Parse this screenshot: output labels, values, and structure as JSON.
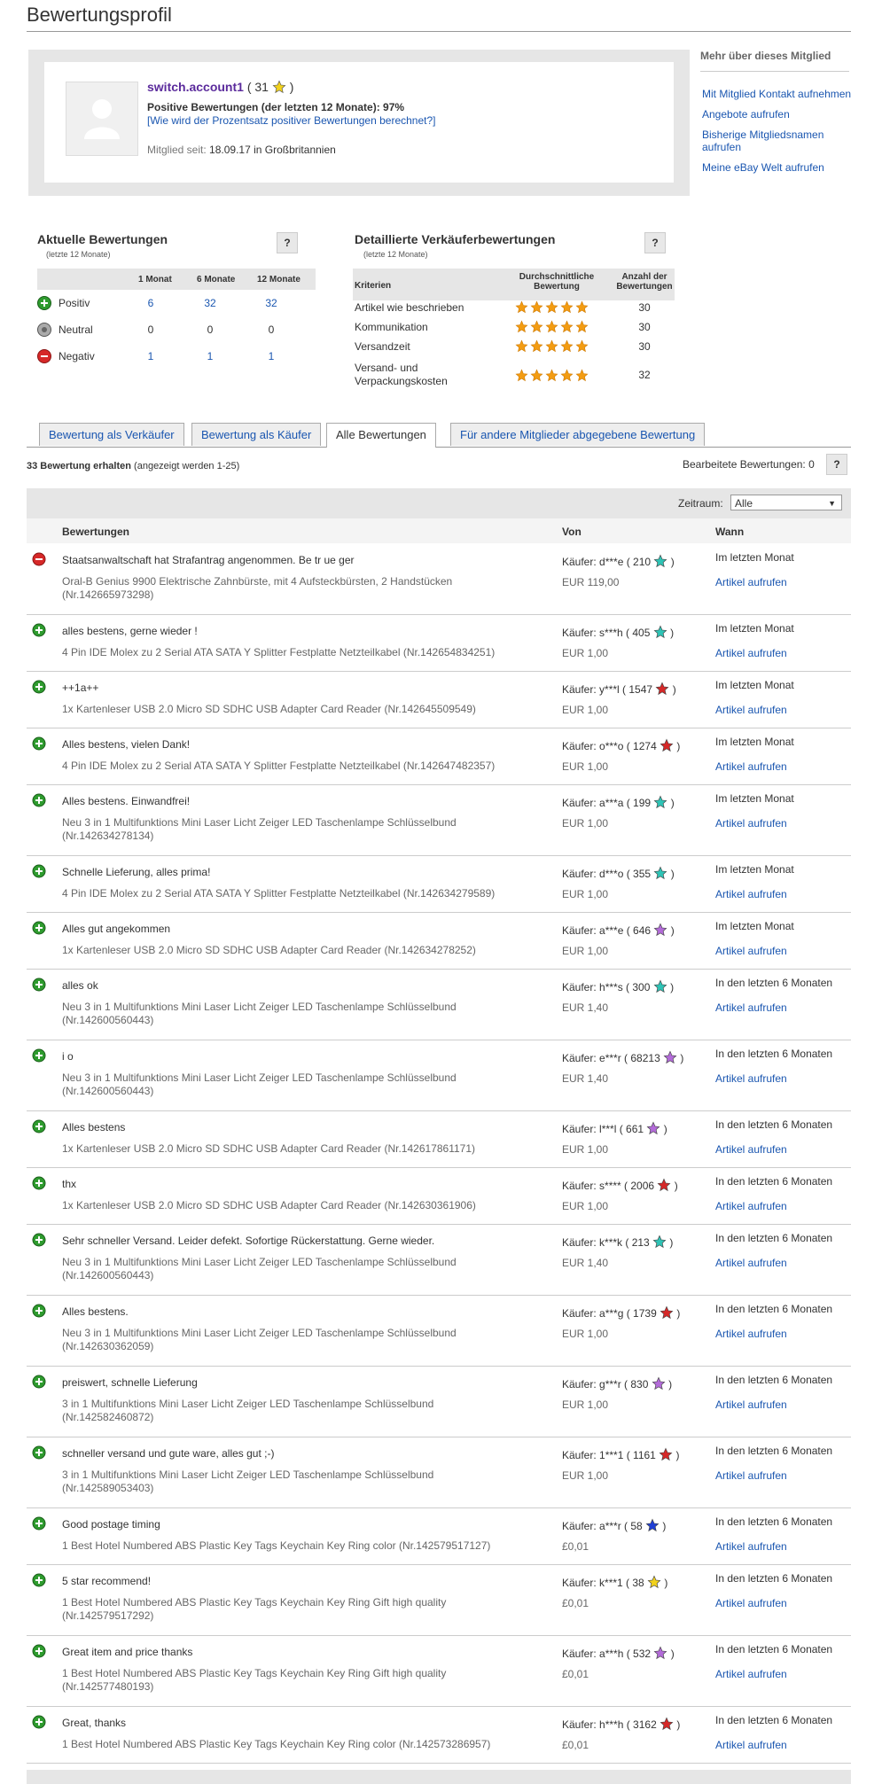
{
  "page": {
    "title": "Bewertungsprofil"
  },
  "profile": {
    "username": "switch.account1",
    "score_prefix": "( 31",
    "score_suffix": ")",
    "positive_line": "Positive Bewertungen (der letzten 12 Monate): 97%",
    "how_link": "[Wie wird der Prozentsatz positiver Bewertungen berechnet?]",
    "member_since_label": "Mitglied seit:",
    "member_since_value": "18.09.17 in Großbritannien"
  },
  "sidebar": {
    "title": "Mehr über dieses Mitglied",
    "links": [
      "Mit Mitglied Kontakt aufnehmen",
      "Angebote aufrufen",
      "Bisherige Mitgliedsnamen aufrufen",
      "Meine eBay Welt aufrufen"
    ]
  },
  "current": {
    "title": "Aktuelle Bewertungen",
    "subtitle": "(letzte 12 Monate)",
    "help": "?",
    "headers": [
      "1 Monat",
      "6 Monate",
      "12 Monate"
    ],
    "rows": [
      {
        "label": "Positiv",
        "values": [
          "6",
          "32",
          "32"
        ],
        "color": "#2e9b2e"
      },
      {
        "label": "Neutral",
        "values": [
          "0",
          "0",
          "0"
        ],
        "color": "#888888"
      },
      {
        "label": "Negativ",
        "values": [
          "1",
          "1",
          "1"
        ],
        "color": "#d62828"
      }
    ]
  },
  "detailed": {
    "title": "Detaillierte Verkäuferbewertungen",
    "subtitle": "(letzte 12 Monate)",
    "help": "?",
    "headers": {
      "criteria": "Kriterien",
      "avg": "Durchschnittliche Bewertung",
      "count": "Anzahl der Bewertungen"
    },
    "rows": [
      {
        "label": "Artikel wie beschrieben",
        "count": "30",
        "stars": 5
      },
      {
        "label": "Kommunikation",
        "count": "30",
        "stars": 5
      },
      {
        "label": "Versandzeit",
        "count": "30",
        "stars": 5
      },
      {
        "label": "Versand- und Verpackungskosten",
        "count": "32",
        "stars": 5
      }
    ]
  },
  "tabs": [
    "Bewertung als Verkäufer",
    "Bewertung als Käufer",
    "Alle Bewertungen",
    "Für andere Mitglieder abgegebene Bewertung"
  ],
  "counts": {
    "received": "33 Bewertung erhalten",
    "shown": "(angezeigt werden 1-25)",
    "edited": "Bearbeitete Bewertungen: 0",
    "help": "?"
  },
  "filter": {
    "label": "Zeitraum:",
    "value": "Alle"
  },
  "table_headers": {
    "comment": "Bewertungen",
    "from": "Von",
    "when": "Wann"
  },
  "view_label": "Artikel aufrufen",
  "feedback": [
    {
      "type": "neg",
      "comment": "Staatsanwaltschaft hat Strafantrag angenommen. Be tr ue ger",
      "item": "Oral-B Genius 9900 Elektrische Zahnbürste, mit 4 Aufsteckbürsten, 2 Handstücken (Nr.142665973298)",
      "buyer": "Käufer: d***e ( 210",
      "star": "#2ec4b6",
      "price": "EUR 119,00",
      "when": "Im letzten Monat"
    },
    {
      "type": "pos",
      "comment": "alles bestens, gerne wieder !",
      "item": "4 Pin IDE Molex zu 2 Serial ATA SATA Y Splitter Festplatte Netzteilkabel (Nr.142654834251)",
      "buyer": "Käufer: s***h ( 405",
      "star": "#2ec4b6",
      "price": "EUR 1,00",
      "when": "Im letzten Monat"
    },
    {
      "type": "pos",
      "comment": "++1a++",
      "item": "1x Kartenleser USB 2.0 Micro SD SDHC USB Adapter Card Reader (Nr.142645509549)",
      "buyer": "Käufer: y***l ( 1547",
      "star": "#d62828",
      "price": "EUR 1,00",
      "when": "Im letzten Monat"
    },
    {
      "type": "pos",
      "comment": "Alles bestens, vielen Dank!",
      "item": "4 Pin IDE Molex zu 2 Serial ATA SATA Y Splitter Festplatte Netzteilkabel (Nr.142647482357)",
      "buyer": "Käufer: o***o ( 1274",
      "star": "#d62828",
      "price": "EUR 1,00",
      "when": "Im letzten Monat"
    },
    {
      "type": "pos",
      "comment": "Alles bestens. Einwandfrei!",
      "item": "Neu 3 in 1 Multifunktions Mini Laser Licht Zeiger LED Taschenlampe Schlüsselbund (Nr.142634278134)",
      "buyer": "Käufer: a***a ( 199",
      "star": "#2ec4b6",
      "price": "EUR 1,00",
      "when": "Im letzten Monat"
    },
    {
      "type": "pos",
      "comment": "Schnelle Lieferung, alles prima!",
      "item": "4 Pin IDE Molex zu 2 Serial ATA SATA Y Splitter Festplatte Netzteilkabel (Nr.142634279589)",
      "buyer": "Käufer: d***o ( 355",
      "star": "#2ec4b6",
      "price": "EUR 1,00",
      "when": "Im letzten Monat"
    },
    {
      "type": "pos",
      "comment": "Alles gut angekommen",
      "item": "1x Kartenleser USB 2.0 Micro SD SDHC USB Adapter Card Reader (Nr.142634278252)",
      "buyer": "Käufer: a***e ( 646",
      "star": "#b36bd9",
      "price": "EUR 1,00",
      "when": "Im letzten Monat"
    },
    {
      "type": "pos",
      "comment": "alles ok",
      "item": "Neu 3 in 1 Multifunktions Mini Laser Licht Zeiger LED Taschenlampe Schlüsselbund (Nr.142600560443)",
      "buyer": "Käufer: h***s ( 300",
      "star": "#2ec4b6",
      "price": "EUR 1,40",
      "when": "In den letzten 6 Monaten"
    },
    {
      "type": "pos",
      "comment": "i o",
      "item": "Neu 3 in 1 Multifunktions Mini Laser Licht Zeiger LED Taschenlampe Schlüsselbund (Nr.142600560443)",
      "buyer": "Käufer: e***r ( 68213",
      "star": "#b36bd9",
      "price": "EUR 1,40",
      "when": "In den letzten 6 Monaten"
    },
    {
      "type": "pos",
      "comment": "Alles bestens",
      "item": "1x Kartenleser USB 2.0 Micro SD SDHC USB Adapter Card Reader (Nr.142617861171)",
      "buyer": "Käufer: l***l ( 661",
      "star": "#b36bd9",
      "price": "EUR 1,00",
      "when": "In den letzten 6 Monaten"
    },
    {
      "type": "pos",
      "comment": "thx",
      "item": "1x Kartenleser USB 2.0 Micro SD SDHC USB Adapter Card Reader (Nr.142630361906)",
      "buyer": "Käufer: s**** ( 2006",
      "star": "#d62828",
      "price": "EUR 1,00",
      "when": "In den letzten 6 Monaten"
    },
    {
      "type": "pos",
      "comment": "Sehr schneller Versand. Leider defekt. Sofortige Rückerstattung. Gerne wieder.",
      "item": "Neu 3 in 1 Multifunktions Mini Laser Licht Zeiger LED Taschenlampe Schlüsselbund (Nr.142600560443)",
      "buyer": "Käufer: k***k ( 213",
      "star": "#2ec4b6",
      "price": "EUR 1,40",
      "when": "In den letzten 6 Monaten"
    },
    {
      "type": "pos",
      "comment": "Alles bestens.",
      "item": "Neu 3 in 1 Multifunktions Mini Laser Licht Zeiger LED Taschenlampe Schlüsselbund (Nr.142630362059)",
      "buyer": "Käufer: a***g ( 1739",
      "star": "#d62828",
      "price": "EUR 1,00",
      "when": "In den letzten 6 Monaten"
    },
    {
      "type": "pos",
      "comment": "preiswert, schnelle Lieferung",
      "item": "3 in 1 Multifunktions Mini Laser Licht Zeiger LED Taschenlampe Schlüsselbund (Nr.142582460872)",
      "buyer": "Käufer: g***r ( 830",
      "star": "#b36bd9",
      "price": "EUR 1,00",
      "when": "In den letzten 6 Monaten"
    },
    {
      "type": "pos",
      "comment": "schneller versand und gute ware, alles gut ;-)",
      "item": "3 in 1 Multifunktions Mini Laser Licht Zeiger LED Taschenlampe Schlüsselbund (Nr.142589053403)",
      "buyer": "Käufer: 1***1 ( 1161",
      "star": "#d62828",
      "price": "EUR 1,00",
      "when": "In den letzten 6 Monaten"
    },
    {
      "type": "pos",
      "comment": "Good postage timing",
      "item": "1 Best Hotel Numbered ABS Plastic Key Tags Keychain Key Ring color (Nr.142579517127)",
      "buyer": "Käufer: a***r ( 58",
      "star": "#1f3fd6",
      "price": "£0,01",
      "when": "In den letzten 6 Monaten"
    },
    {
      "type": "pos",
      "comment": "5 star recommend!",
      "item": "1 Best Hotel Numbered ABS Plastic Key Tags Keychain Key Ring Gift high quality (Nr.142579517292)",
      "buyer": "Käufer: k***1 ( 38",
      "star": "#f2d21b",
      "price": "£0,01",
      "when": "In den letzten 6 Monaten"
    },
    {
      "type": "pos",
      "comment": "Great item and price thanks",
      "item": "1 Best Hotel Numbered ABS Plastic Key Tags Keychain Key Ring Gift high quality (Nr.142577480193)",
      "buyer": "Käufer: a***h ( 532",
      "star": "#b36bd9",
      "price": "£0,01",
      "when": "In den letzten 6 Monaten"
    },
    {
      "type": "pos",
      "comment": "Great, thanks",
      "item": "1 Best Hotel Numbered ABS Plastic Key Tags Keychain Key Ring color (Nr.142573286957)",
      "buyer": "Käufer: h***h ( 3162",
      "star": "#d62828",
      "price": "£0,01",
      "when": "In den letzten 6 Monaten"
    }
  ]
}
